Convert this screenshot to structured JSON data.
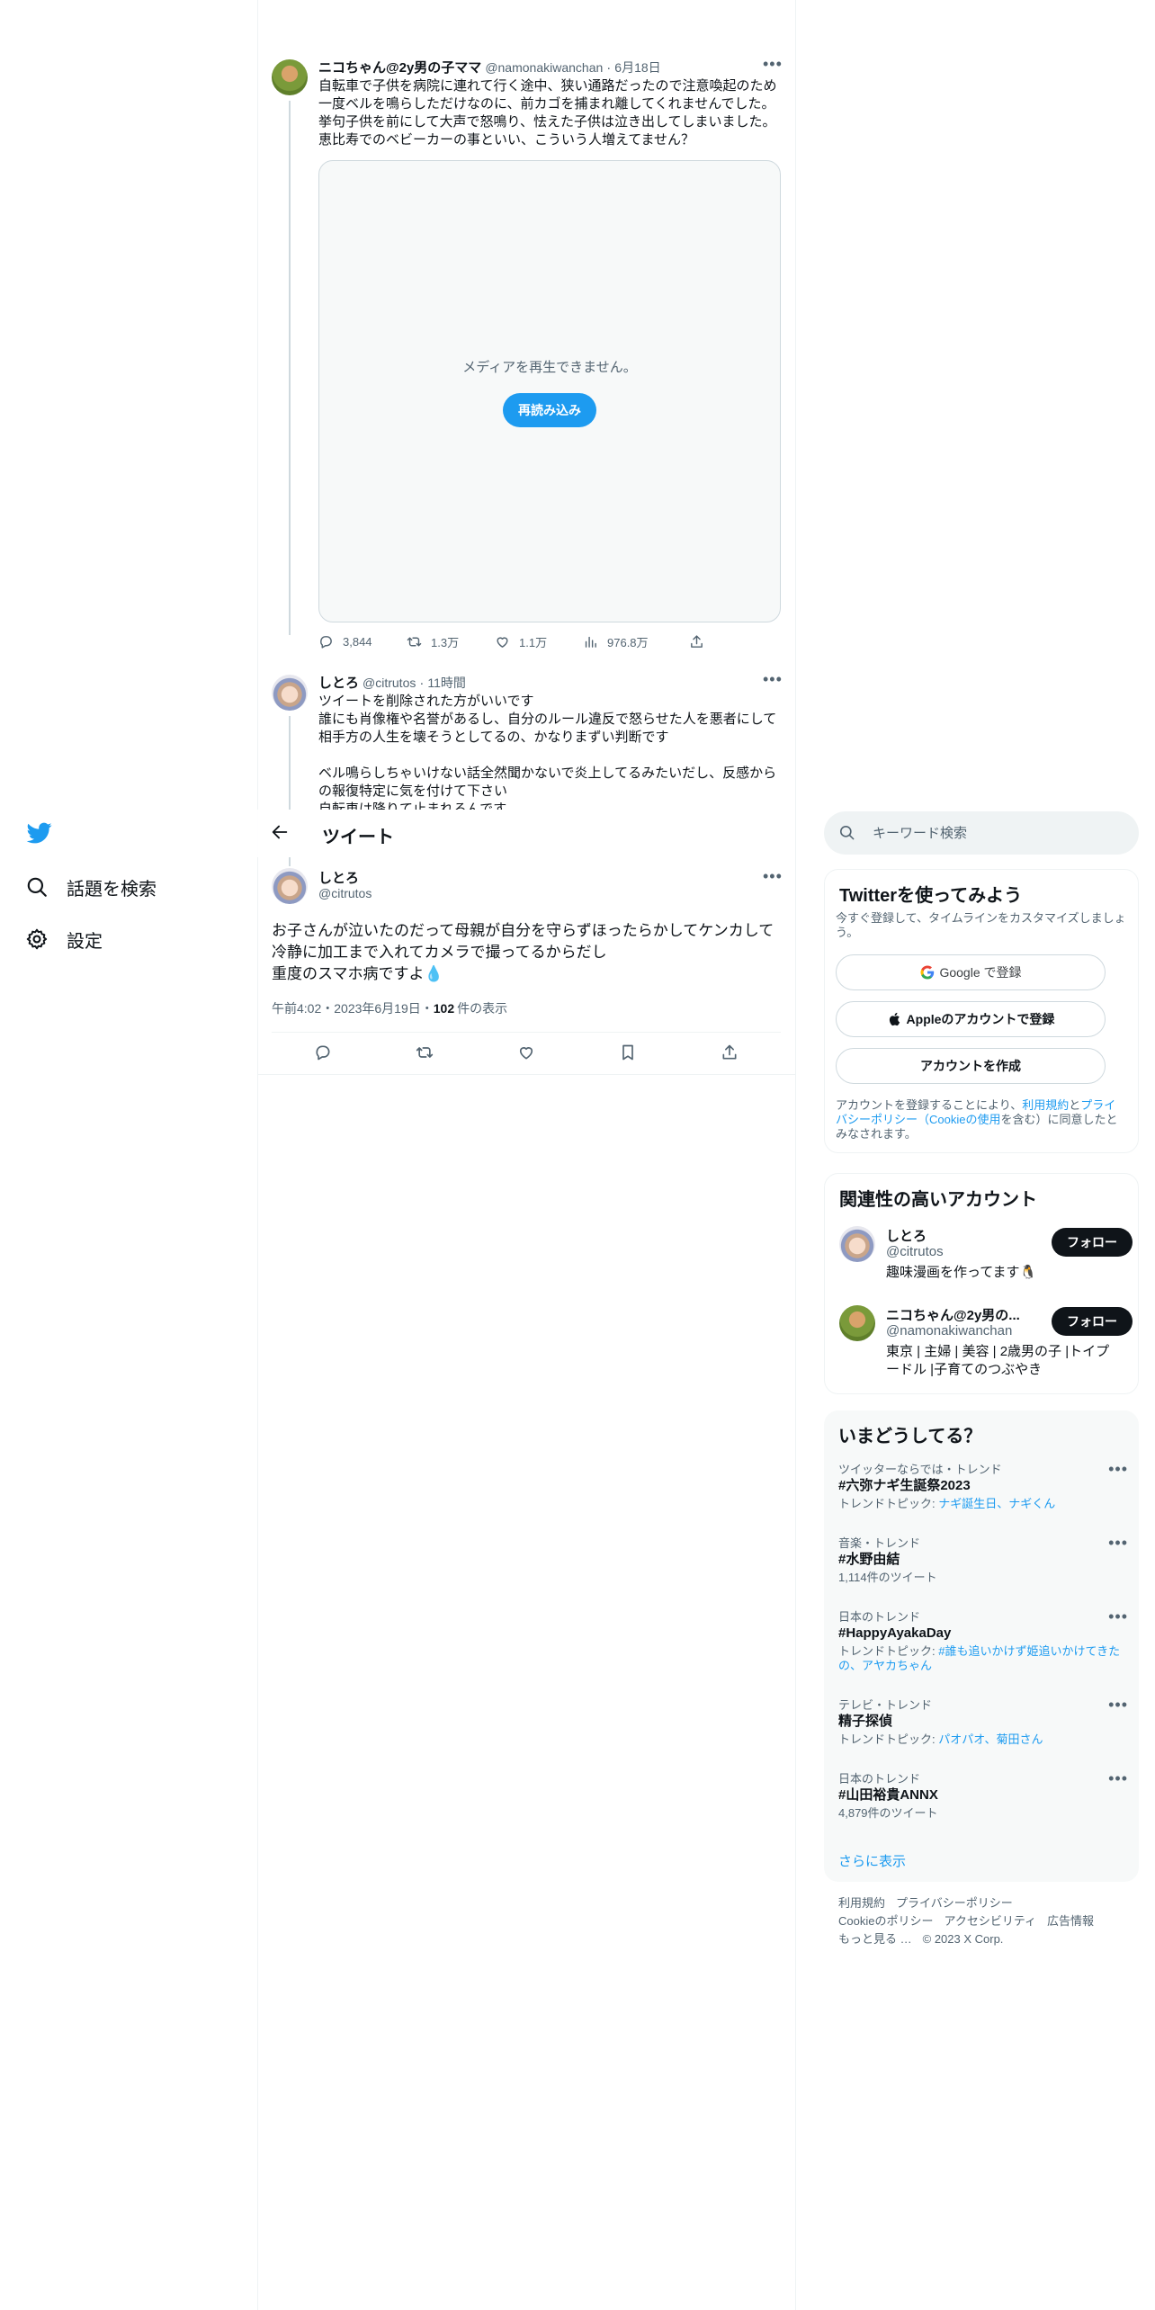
{
  "nav": {
    "items": [
      {
        "label": "話題を検索"
      },
      {
        "label": "設定"
      }
    ]
  },
  "header": {
    "title": "ツイート"
  },
  "quoted_tweet": {
    "name": "ニコちゃん@2y男の子ママ",
    "handle": "@namonakiwanchan",
    "time": "6月18日",
    "text": "自転車で子供を病院に連れて行く途中、狭い通路だったので注意喚起のため一度ベルを鳴らしただけなのに、前カゴを捕まれ離してくれませんでした。\n挙句子供を前にして大声で怒鳴り、怯えた子供は泣き出してしまいました。\n恵比寿でのベビーカーの事といい、こういう人増えてません？",
    "media_message": "メディアを再生できません。",
    "reload_label": "再読み込み",
    "stats": {
      "replies": "3,844",
      "retweets": "1.3万",
      "likes": "1.1万",
      "views": "976.8万"
    }
  },
  "reply_tweet": {
    "name": "しとろ",
    "handle": "@citrutos",
    "time": "11時間",
    "text": "ツイートを削除された方がいいです\n誰にも肖像権や名誉があるし、自分のルール違反で怒らせた人を悪者にして相手方の人生を壊そうとしてるの、かなりまずい判断です\n\nベル鳴らしちゃいけない話全然聞かないで炎上してるみたいだし、反感からの報復特定に気を付けて下さい\n自転車は降りて止まれるんです"
  },
  "main_tweet": {
    "name": "しとろ",
    "handle": "@citrutos",
    "text": "お子さんが泣いたのだって母親が自分を守らずほったらかしてケンカして冷静に加工まで入れてカメラで撮ってるからだし\n重度のスマホ病ですよ💧",
    "timestamp": "午前4:02・2023年6月19日・",
    "views_count": "102",
    "views_label": "件の表示"
  },
  "search": {
    "placeholder": "キーワード検索"
  },
  "signup": {
    "title": "Twitterを使ってみよう",
    "subtitle": "今すぐ登録して、タイムラインをカスタマイズしましょう。",
    "google_label": "Google で登録",
    "apple_label": "Appleのアカウントで登録",
    "create_label": "アカウントを作成",
    "legal_prefix": "アカウントを登録することにより、",
    "legal_terms": "利用規約",
    "legal_and": "と",
    "legal_privacy": "プライバシーポリシー",
    "legal_cookie": "（Cookieの使用",
    "legal_suffix": "を含む）に同意したとみなされます。"
  },
  "related": {
    "title": "関連性の高いアカウント",
    "follow_label": "フォロー",
    "accounts": [
      {
        "name": "しとろ",
        "handle": "@citrutos",
        "bio": "趣味漫画を作ってます🐧"
      },
      {
        "name": "ニコちゃん@2y男の...",
        "handle": "@namonakiwanchan",
        "bio": "東京 | 主婦 | 美容 | 2歳男の子 |トイプードル |子育てのつぶやき"
      }
    ]
  },
  "trends": {
    "title": "いまどうしてる？",
    "items": [
      {
        "context": "ツイッターならでは・トレンド",
        "name": "#六弥ナギ生誕祭2023",
        "meta_prefix": "トレンドトピック: ",
        "meta_link": "ナギ誕生日、ナギくん"
      },
      {
        "context": "音楽・トレンド",
        "name": "#水野由結",
        "meta_prefix": "1,114件のツイート",
        "meta_link": ""
      },
      {
        "context": "日本のトレンド",
        "name": "#HappyAyakaDay",
        "meta_prefix": "トレンドトピック: ",
        "meta_link": "#誰も追いかけず姫追いかけてきたの、アヤカちゃん"
      },
      {
        "context": "テレビ・トレンド",
        "name": "精子探偵",
        "meta_prefix": "トレンドトピック: ",
        "meta_link": "パオパオ、菊田さん"
      },
      {
        "context": "日本のトレンド",
        "name": "#山田裕貴ANNX",
        "meta_prefix": "4,879件のツイート",
        "meta_link": ""
      }
    ],
    "show_more": "さらに表示"
  },
  "footer": {
    "links": [
      "利用規約",
      "プライバシーポリシー",
      "Cookieのポリシー",
      "アクセシビリティ",
      "広告情報",
      "もっと見る …"
    ],
    "copyright": "© 2023 X Corp."
  },
  "colors": {
    "accent": "#1d9bf0",
    "text": "#0f1419",
    "muted": "#536471"
  }
}
